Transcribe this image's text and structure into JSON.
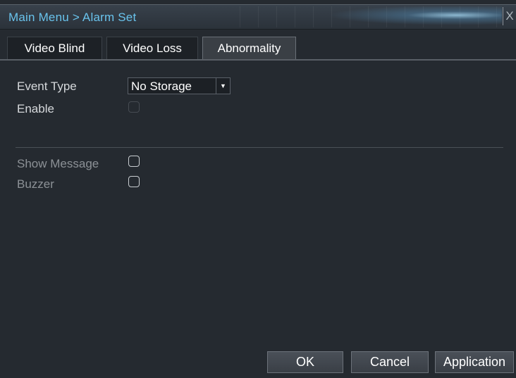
{
  "titlebar": {
    "title": "Main Menu > Alarm Set",
    "close_label": "X"
  },
  "tabs": [
    {
      "label": "Video Blind",
      "active": false
    },
    {
      "label": "Video Loss",
      "active": false
    },
    {
      "label": "Abnormality",
      "active": true
    }
  ],
  "form": {
    "event_type_label": "Event Type",
    "event_type_value": "No Storage",
    "event_type_arrow": "▼",
    "enable_label": "Enable",
    "enable_checked": false,
    "show_message_label": "Show Message",
    "show_message_checked": false,
    "buzzer_label": "Buzzer",
    "buzzer_checked": false
  },
  "buttons": {
    "ok": "OK",
    "cancel": "Cancel",
    "apply": "Application"
  },
  "colors": {
    "title_text": "#69c3ec",
    "background": "#252a30",
    "active_tab": "#3a3f45"
  }
}
